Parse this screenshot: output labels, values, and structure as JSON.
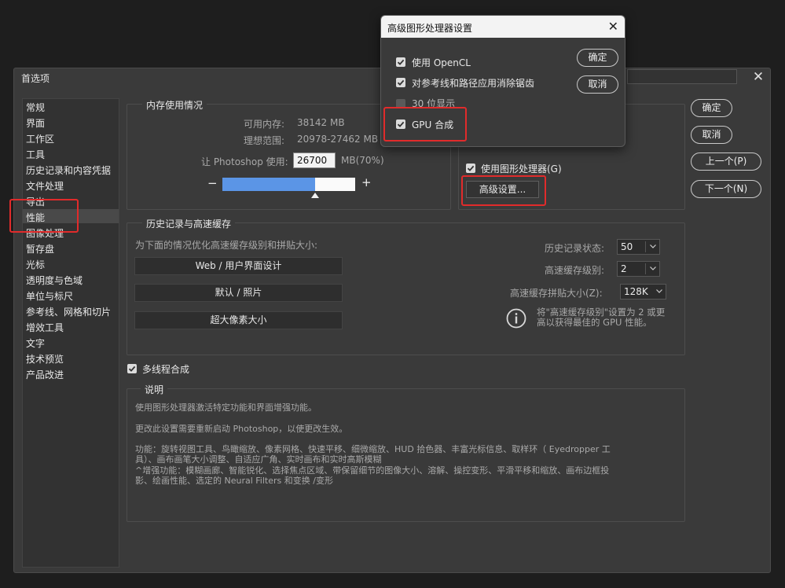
{
  "dialog": {
    "title": "首选项",
    "close_glyph": "✕",
    "sidebar": [
      "常规",
      "界面",
      "工作区",
      "工具",
      "历史记录和内容凭据",
      "文件处理",
      "导出",
      "性能",
      "图像处理",
      "暂存盘",
      "光标",
      "透明度与色域",
      "单位与标尺",
      "参考线、网格和切片",
      "增效工具",
      "文字",
      "技术预览",
      "产品改进"
    ],
    "selected_item": "性能",
    "buttons": {
      "ok": "确定",
      "cancel": "取消",
      "prev": "上一个(P)",
      "next": "下一个(N)"
    }
  },
  "memory": {
    "legend": "内存使用情况",
    "available_label": "可用内存:",
    "available_value": "38142 MB",
    "ideal_label": "理想范围:",
    "ideal_value": "20978-27462 MB",
    "let_label": "让 Photoshop 使用:",
    "let_value": "26700",
    "percent": "MB(70%)",
    "minus": "−",
    "plus": "+",
    "usage_fraction": 0.7
  },
  "gpu": {
    "use_gpu_label": "使用图形处理器(G)",
    "use_gpu_checked": true,
    "advanced_button": "高级设置..."
  },
  "history": {
    "legend": "历史记录与高速缓存",
    "optimize_label": "为下面的情况优化高速缓存级别和拼贴大小:",
    "presets": [
      "Web / 用户界面设计",
      "默认 / 照片",
      "超大像素大小"
    ],
    "states_label": "历史记录状态:",
    "states_value": "50",
    "cache_levels_label": "高速缓存级别:",
    "cache_levels_value": "2",
    "tile_size_label": "高速缓存拼贴大小(Z):",
    "tile_size_value": "128K",
    "info_line1": "将\"高速缓存级别\"设置为 2 或更",
    "info_line2": "高以获得最佳的 GPU 性能。"
  },
  "multithread": {
    "label": "多线程合成",
    "checked": true
  },
  "description": {
    "legend": "说明",
    "line1": "使用图形处理器激活特定功能和界面增强功能。",
    "line2": "更改此设置需要重新启动 Photoshop，以使更改生效。",
    "line3": "功能：旋转视图工具、鸟瞰缩放、像素网格、快速平移、细微缩放、HUD 拾色器、丰富光标信息、取样环（ Eyedropper 工",
    "line4": "具）、画布画笔大小调整、自适应广角、实时画布和实时高斯模糊",
    "line5": "^增强功能：模糊画廊、智能锐化、选择焦点区域、带保留细节的图像大小、溶解、操控变形、平滑平移和缩放、画布边框投",
    "line6": "影、绘画性能、选定的 Neural Filters 和变换 /变形"
  },
  "advanced_dialog": {
    "title": "高级图形处理器设置",
    "close_glyph": "✕",
    "options": [
      {
        "label": "使用 OpenCL",
        "checked": true
      },
      {
        "label": "对参考线和路径应用消除锯齿",
        "checked": true
      },
      {
        "label": "30 位显示",
        "checked": false
      },
      {
        "label": "GPU 合成",
        "checked": true
      }
    ],
    "ok": "确定",
    "cancel": "取消"
  },
  "colors": {
    "highlight_box": "#e12b2b",
    "slider_fill": "#5b95e6",
    "background": "#1e1e1e",
    "dialog_bg": "#3a3a3a"
  }
}
